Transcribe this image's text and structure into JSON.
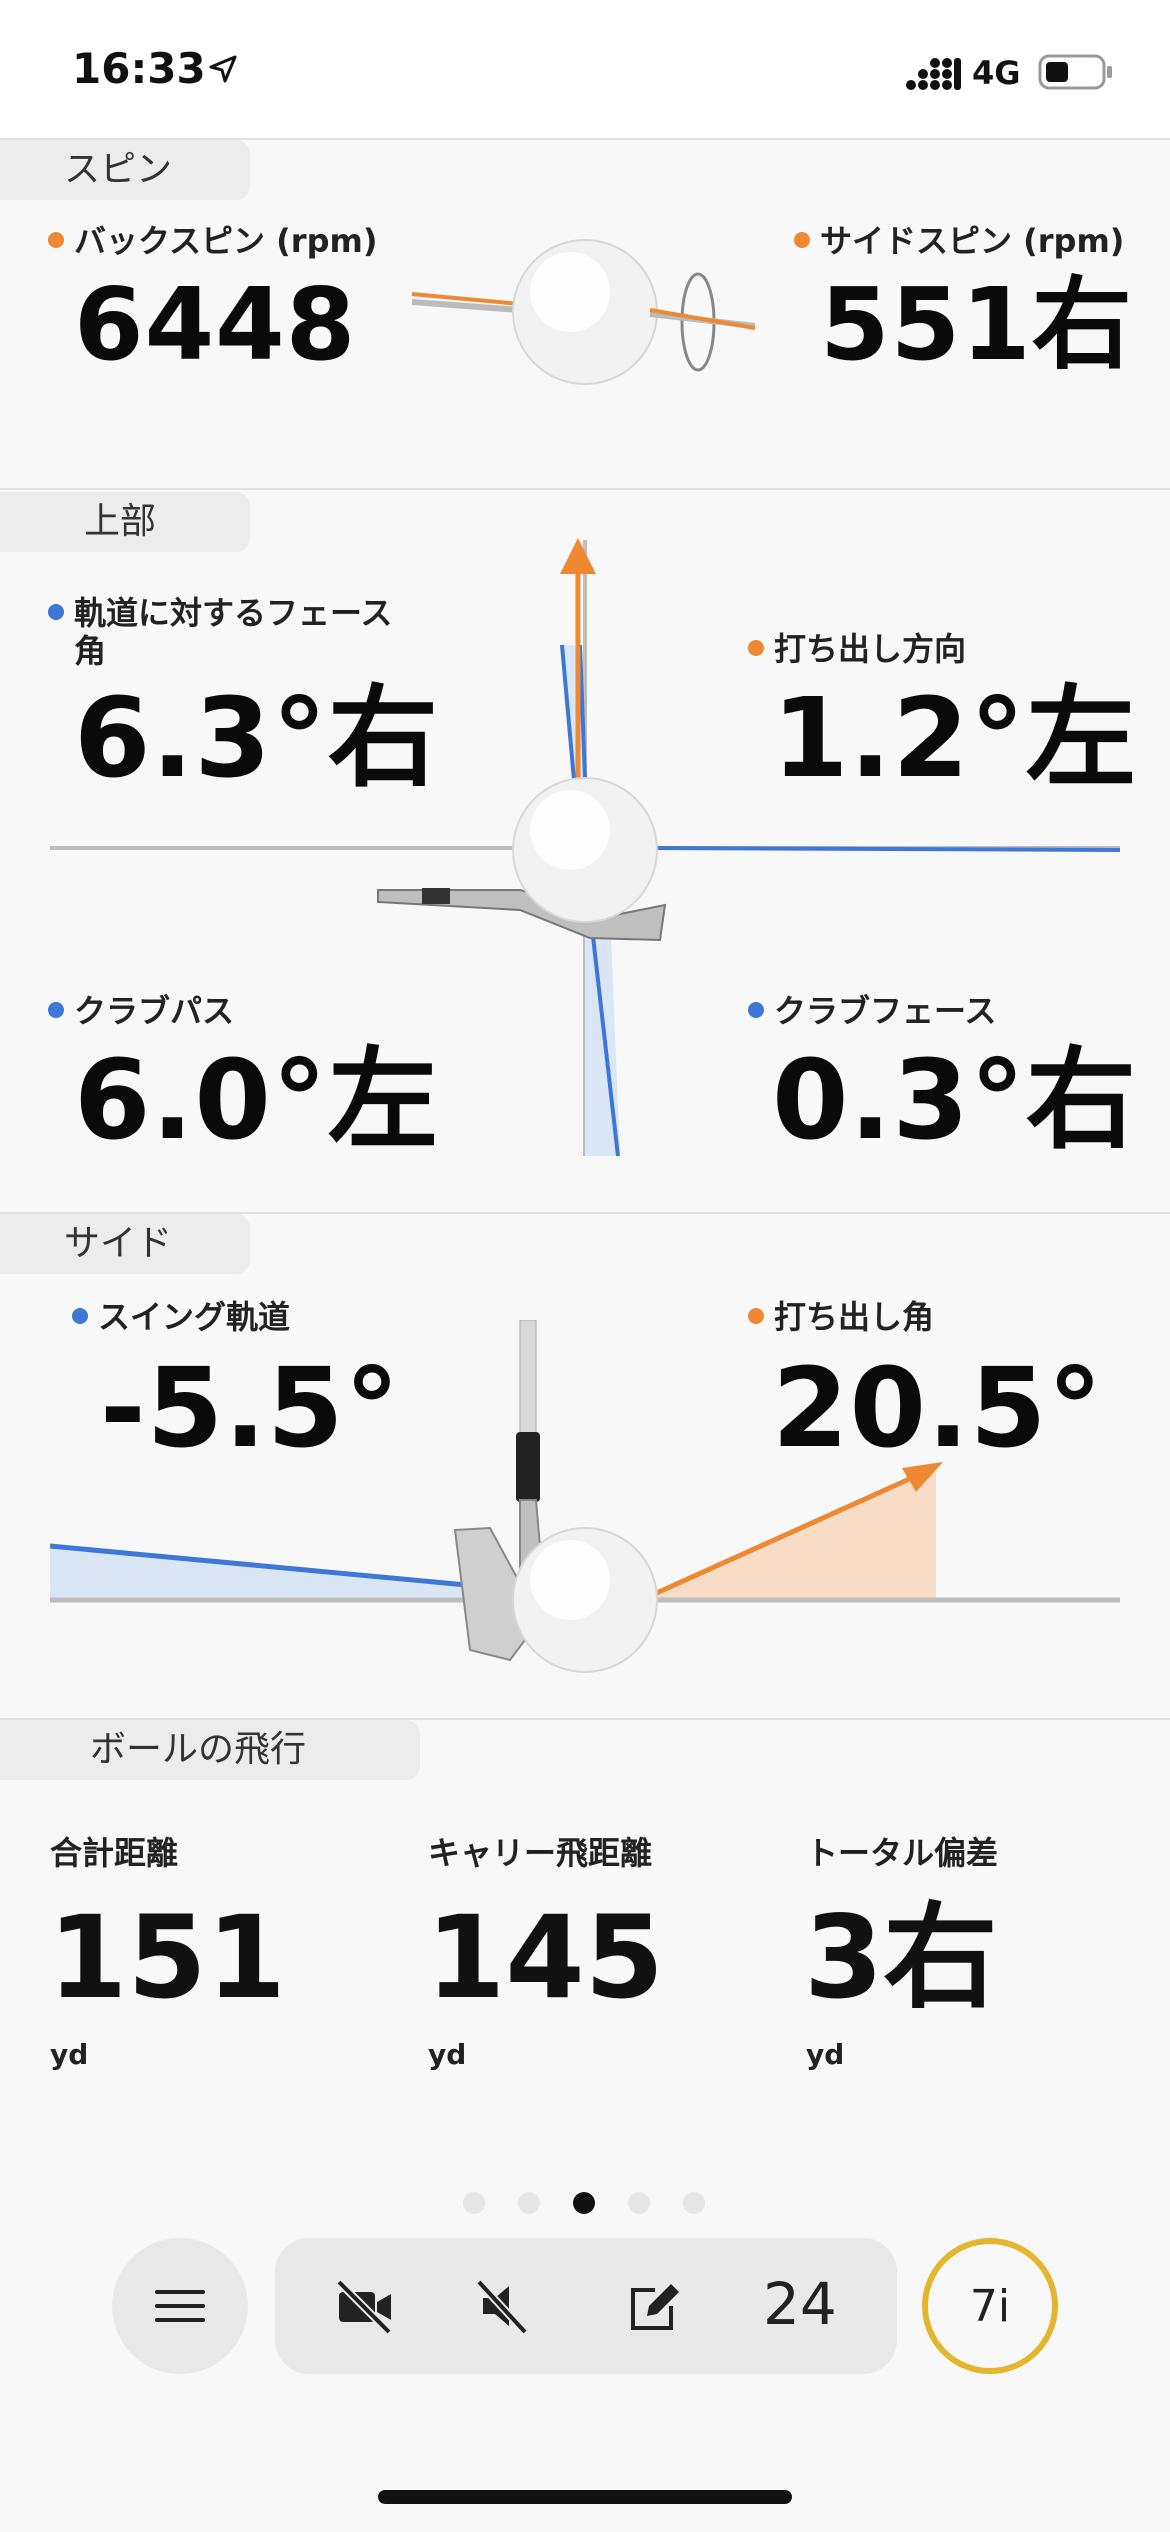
{
  "status_bar": {
    "time": "16:33",
    "network": "4G"
  },
  "sections": {
    "spin": {
      "title": "スピン"
    },
    "top": {
      "title": "上部"
    },
    "side": {
      "title": "サイド"
    },
    "flight": {
      "title": "ボールの飛行"
    }
  },
  "spin": {
    "backspin": {
      "label": "バックスピン (rpm)",
      "value": "6448"
    },
    "sidespin": {
      "label": "サイドスピン (rpm)",
      "value": "551右"
    }
  },
  "top_view": {
    "face_to_path": {
      "label_line1": "軌道に対するフェース",
      "label_line2": "角",
      "value": "6.3°右"
    },
    "launch_direction": {
      "label": "打ち出し方向",
      "value": "1.2°左"
    },
    "club_path": {
      "label": "クラブパス",
      "value": "6.0°左"
    },
    "club_face": {
      "label": "クラブフェース",
      "value": "0.3°右"
    }
  },
  "side_view": {
    "swing_path": {
      "label": "スイング軌道",
      "value": "-5.5°"
    },
    "launch_angle": {
      "label": "打ち出し角",
      "value": "20.5°"
    }
  },
  "ball_flight": {
    "total": {
      "label": "合計距離",
      "value": "151",
      "unit": "yd"
    },
    "carry": {
      "label": "キャリー飛距離",
      "value": "145",
      "unit": "yd"
    },
    "deviation": {
      "label": "トータル偏差",
      "value": "3右",
      "unit": "yd"
    }
  },
  "pagination": {
    "count": 5,
    "active_index": 2
  },
  "toolbar": {
    "shot_count": "24",
    "club": "7i"
  },
  "colors": {
    "orange": "#ee8833",
    "blue": "#3d78d8",
    "club_ring": "#e6b530"
  },
  "icons": [
    "location-arrow-icon",
    "signal-icon",
    "battery-icon",
    "menu-icon",
    "video-off-icon",
    "sound-off-icon",
    "edit-icon"
  ]
}
